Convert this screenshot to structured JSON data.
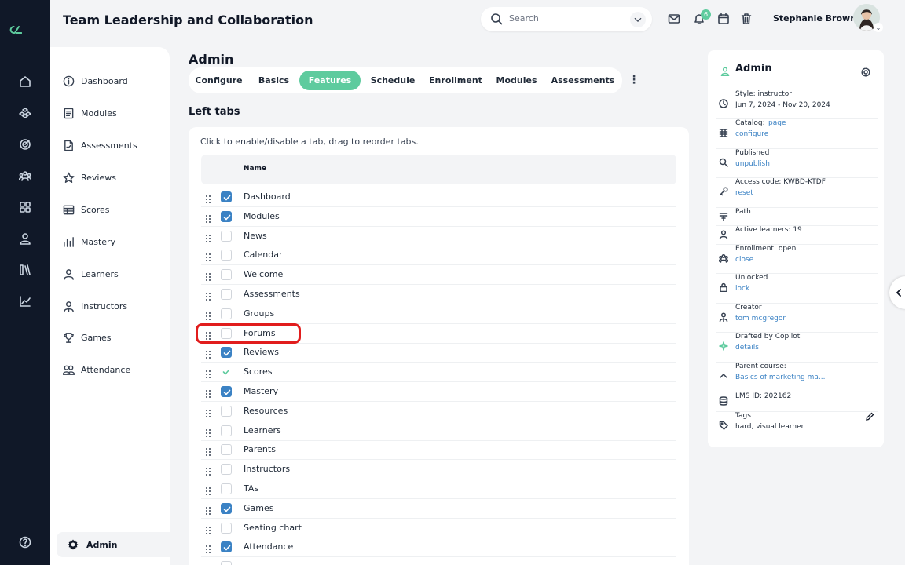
{
  "app": {
    "title": "Team Leadership and Collaboration",
    "brand_color": "#5ecb9e",
    "link_color": "#3b82c4",
    "highlight_color": "#e11d1d"
  },
  "header": {
    "search_placeholder": "Search",
    "notification_count": "6",
    "user_name": "Stephanie Brown"
  },
  "rail_icons": [
    "home-icon",
    "modules-icon",
    "target-icon",
    "people-icon",
    "grid-icon",
    "user-icon",
    "library-icon",
    "chart-icon",
    "help-icon"
  ],
  "sidebar": {
    "items": [
      {
        "label": "Dashboard",
        "icon": "info-icon"
      },
      {
        "label": "Modules",
        "icon": "modules-icon"
      },
      {
        "label": "Assessments",
        "icon": "assessment-icon"
      },
      {
        "label": "Reviews",
        "icon": "star-icon"
      },
      {
        "label": "Scores",
        "icon": "table-icon"
      },
      {
        "label": "Mastery",
        "icon": "bar-chart-icon"
      },
      {
        "label": "Learners",
        "icon": "learner-icon"
      },
      {
        "label": "Instructors",
        "icon": "instructor-icon"
      },
      {
        "label": "Games",
        "icon": "trophy-icon"
      },
      {
        "label": "Attendance",
        "icon": "attendance-icon"
      }
    ],
    "admin_label": "Admin"
  },
  "main": {
    "section_title": "Admin",
    "tabs": [
      {
        "label": "Configure",
        "active": false
      },
      {
        "label": "Basics",
        "active": false
      },
      {
        "label": "Features",
        "active": true
      },
      {
        "label": "Schedule",
        "active": false
      },
      {
        "label": "Enrollment",
        "active": false
      },
      {
        "label": "Modules",
        "active": false
      },
      {
        "label": "Assessments",
        "active": false
      }
    ],
    "more_label": "⋮",
    "subtitle": "Left tabs",
    "instructions": "Click to enable/disable a tab, drag to reorder tabs.",
    "column_header": "Name",
    "rows": [
      {
        "name": "Dashboard",
        "state": "checked"
      },
      {
        "name": "Modules",
        "state": "checked"
      },
      {
        "name": "News",
        "state": "unchecked"
      },
      {
        "name": "Calendar",
        "state": "unchecked"
      },
      {
        "name": "Welcome",
        "state": "unchecked"
      },
      {
        "name": "Assessments",
        "state": "unchecked"
      },
      {
        "name": "Groups",
        "state": "unchecked"
      },
      {
        "name": "Forums",
        "state": "unchecked"
      },
      {
        "name": "Reviews",
        "state": "checked"
      },
      {
        "name": "Scores",
        "state": "tick"
      },
      {
        "name": "Mastery",
        "state": "checked"
      },
      {
        "name": "Resources",
        "state": "unchecked"
      },
      {
        "name": "Learners",
        "state": "unchecked"
      },
      {
        "name": "Parents",
        "state": "unchecked"
      },
      {
        "name": "Instructors",
        "state": "unchecked"
      },
      {
        "name": "TAs",
        "state": "unchecked"
      },
      {
        "name": "Games",
        "state": "checked"
      },
      {
        "name": "Seating chart",
        "state": "unchecked"
      },
      {
        "name": "Attendance",
        "state": "checked"
      },
      {
        "name": "",
        "state": "unchecked"
      }
    ]
  },
  "right_panel": {
    "title": "Admin",
    "rows": [
      {
        "icon": "clock-icon",
        "line1": "Style: instructor",
        "line2": "Jun 7, 2024 - Nov 20, 2024",
        "line2_link": false
      },
      {
        "icon": "catalog-icon",
        "line1": "Catalog:",
        "line1_link": "page",
        "line2": "configure",
        "line2_link": true
      },
      {
        "icon": "magnify-icon",
        "line1": "Published",
        "line2": "unpublish",
        "line2_link": true
      },
      {
        "icon": "key-icon",
        "line1": "Access code: KWBD-KTDF",
        "line2": "reset",
        "line2_link": true
      },
      {
        "icon": "path-icon",
        "line1": "Path",
        "line2": "",
        "line2_link": false
      },
      {
        "icon": "person-icon",
        "line1": "Active learners: 19",
        "line2": "",
        "line2_link": false
      },
      {
        "icon": "group-icon",
        "line1": "Enrollment: open",
        "line2": "close",
        "line2_link": true
      },
      {
        "icon": "unlock-icon",
        "line1": "Unlocked",
        "line2": "lock",
        "line2_link": true
      },
      {
        "icon": "creator-icon",
        "line1": "Creator",
        "line2": "tom mcgregor",
        "line2_link": true
      },
      {
        "icon": "sparkle-icon",
        "line1": "Drafted by Copilot",
        "line2": "details",
        "line2_link": true
      },
      {
        "icon": "chevron-up-icon",
        "line1": "Parent course:",
        "line2": "Basics of marketing ma...",
        "line2_link": true
      },
      {
        "icon": "database-icon",
        "line1": "LMS ID: 202162",
        "line2": "",
        "line2_link": false
      },
      {
        "icon": "tag-icon",
        "line1": "Tags",
        "line2": "hard, visual learner",
        "line2_link": false
      }
    ]
  }
}
